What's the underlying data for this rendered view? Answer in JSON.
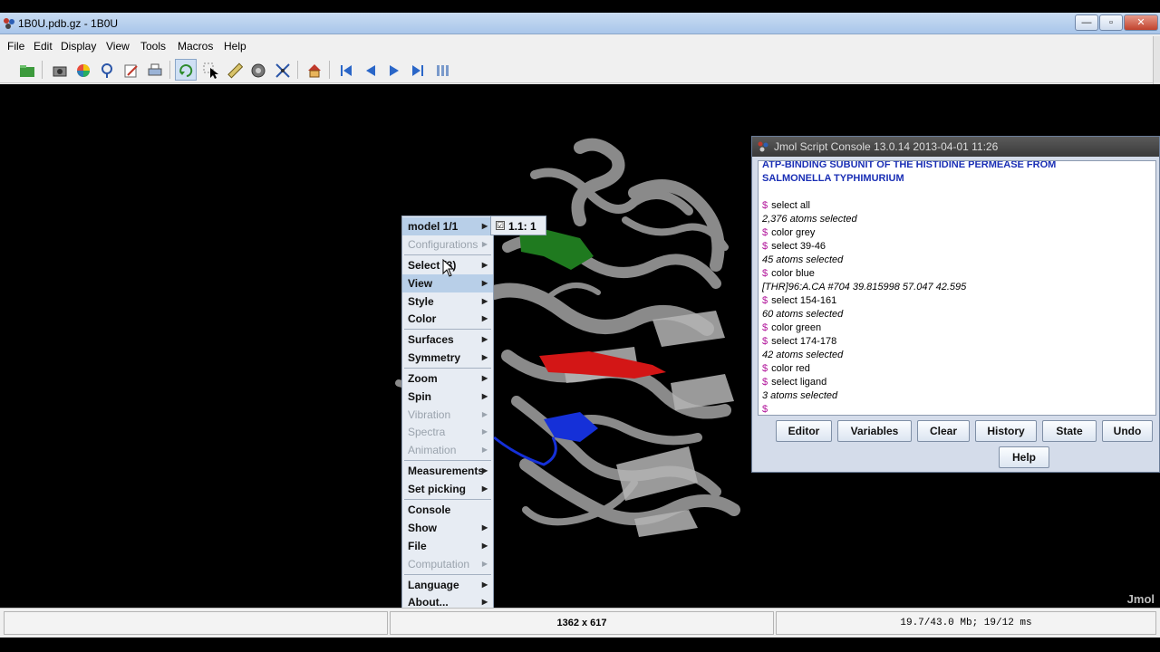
{
  "window": {
    "title": "1B0U.pdb.gz - 1B0U",
    "controls": [
      "—",
      "▫",
      "✕"
    ]
  },
  "menubar": [
    "File",
    "Edit",
    "Display",
    "View",
    "Tools",
    "Macros",
    "Help"
  ],
  "toolbar": {
    "icons": [
      "open-file-icon",
      "camera-icon",
      "color-wheel-icon",
      "search-icon",
      "edit-icon",
      "print-icon",
      "rotate-icon",
      "pick-icon",
      "ruler-icon",
      "spin-icon",
      "translate-icon",
      "home-icon",
      "first-frame-icon",
      "previous-frame-icon",
      "next-frame-icon",
      "last-frame-icon",
      "stop-icon"
    ]
  },
  "viewer": {
    "watermark": "Jmol"
  },
  "popup_menu": {
    "items": [
      {
        "label": "model 1/1",
        "enabled": true,
        "submenu": true,
        "highlighted": true
      },
      {
        "label": "Configurations",
        "enabled": false,
        "submenu": true
      },
      {
        "label": "Select (3)",
        "enabled": true,
        "submenu": true
      },
      {
        "label": "View",
        "enabled": true,
        "submenu": true,
        "highlighted": true
      },
      {
        "label": "Style",
        "enabled": true,
        "submenu": true
      },
      {
        "label": "Color",
        "enabled": true,
        "submenu": true
      },
      {
        "label": "Surfaces",
        "enabled": true,
        "submenu": true
      },
      {
        "label": "Symmetry",
        "enabled": true,
        "submenu": true
      },
      {
        "label": "Zoom",
        "enabled": true,
        "submenu": true
      },
      {
        "label": "Spin",
        "enabled": true,
        "submenu": true
      },
      {
        "label": "Vibration",
        "enabled": false,
        "submenu": true
      },
      {
        "label": "Spectra",
        "enabled": false,
        "submenu": true
      },
      {
        "label": "Animation",
        "enabled": false,
        "submenu": true
      },
      {
        "label": "Measurements",
        "enabled": true,
        "submenu": true
      },
      {
        "label": "Set picking",
        "enabled": true,
        "submenu": true
      },
      {
        "label": "Console",
        "enabled": true,
        "submenu": false
      },
      {
        "label": "Show",
        "enabled": true,
        "submenu": true
      },
      {
        "label": "File",
        "enabled": true,
        "submenu": true
      },
      {
        "label": "Computation",
        "enabled": false,
        "submenu": true
      },
      {
        "label": "Language",
        "enabled": true,
        "submenu": true
      },
      {
        "label": "About...",
        "enabled": true,
        "submenu": true
      }
    ],
    "submenu_model": {
      "label": "1.1: 1",
      "checked": "☑"
    }
  },
  "console": {
    "title": "Jmol Script Console 13.0.14  2013-04-01 11:26",
    "lines": [
      {
        "type": "head",
        "text": "ATP-BINDING SUBUNIT OF THE HISTIDINE PERMEASE FROM"
      },
      {
        "type": "head",
        "text": "SALMONELLA TYPHIMURIUM"
      },
      {
        "type": "blank",
        "text": ""
      },
      {
        "type": "cmd",
        "text": "select all"
      },
      {
        "type": "out",
        "text": "2,376 atoms selected"
      },
      {
        "type": "cmd",
        "text": "color grey"
      },
      {
        "type": "cmd",
        "text": "select 39-46"
      },
      {
        "type": "out",
        "text": "45 atoms selected"
      },
      {
        "type": "cmd",
        "text": "color blue"
      },
      {
        "type": "out",
        "text": "[THR]96:A.CA #704 39.815998 57.047 42.595"
      },
      {
        "type": "cmd",
        "text": "select 154-161"
      },
      {
        "type": "out",
        "text": "60 atoms selected"
      },
      {
        "type": "cmd",
        "text": "color green"
      },
      {
        "type": "cmd",
        "text": "select 174-178"
      },
      {
        "type": "out",
        "text": "42 atoms selected"
      },
      {
        "type": "cmd",
        "text": "color red"
      },
      {
        "type": "cmd",
        "text": "select ligand"
      },
      {
        "type": "out",
        "text": "3 atoms selected"
      },
      {
        "type": "cmd",
        "text": ""
      }
    ],
    "prompt": "$",
    "buttons": [
      "Editor",
      "Variables",
      "Clear",
      "History",
      "State",
      "Undo"
    ],
    "help_button": "Help"
  },
  "statusbar": {
    "left": "",
    "center": "1362 x 617",
    "right": "19.7/43.0 Mb;  19/12 ms"
  }
}
